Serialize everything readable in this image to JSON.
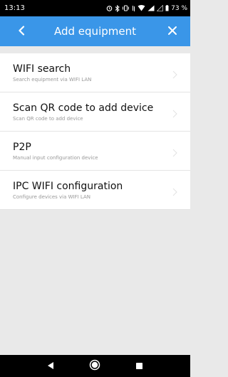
{
  "status_bar": {
    "time": "13:13",
    "battery": "73 %"
  },
  "header": {
    "title": "Add equipment",
    "back_icon": "chevron-left-icon",
    "close_icon": "close-icon",
    "background": "#3a96e8"
  },
  "menu": {
    "items": [
      {
        "title": "WIFI search",
        "subtitle": "Search equipment via WIFI LAN"
      },
      {
        "title": "Scan QR code to add device",
        "subtitle": "Scan QR code to add device"
      },
      {
        "title": "P2P",
        "subtitle": "Manual input configuration device"
      },
      {
        "title": "IPC WIFI configuration",
        "subtitle": "Configure devices via WIFI LAN"
      }
    ]
  },
  "nav_bar": {
    "icons": [
      "back-triangle-icon",
      "home-circle-icon",
      "recents-square-icon"
    ]
  }
}
